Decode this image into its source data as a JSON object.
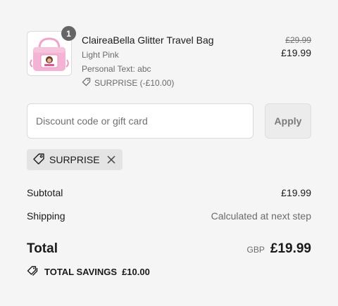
{
  "line_item": {
    "quantity": "1",
    "title": "ClaireaBella Glitter Travel Bag",
    "variant": "Light Pink",
    "personal_text": "Personal Text: abc",
    "discount": "SURPRISE (-£10.00)",
    "original_price": "£29.99",
    "price": "£19.99"
  },
  "discount_form": {
    "placeholder": "Discount code or gift card",
    "apply_label": "Apply"
  },
  "applied_code": {
    "code": "SURPRISE"
  },
  "summary": {
    "subtotal_label": "Subtotal",
    "subtotal_value": "£19.99",
    "shipping_label": "Shipping",
    "shipping_value": "Calculated at next step",
    "total_label": "Total",
    "currency": "GBP",
    "total_value": "£19.99",
    "savings_label": "TOTAL SAVINGS",
    "savings_value": "£10.00"
  },
  "colors": {
    "background": "#f5f5f5",
    "text": "#1a1a1a",
    "muted": "#6b6b6b",
    "bag_pink": "#f2a9cf"
  },
  "icons": {
    "discount_tag": "tag-icon",
    "remove": "close-icon",
    "savings": "double-tag-icon"
  }
}
